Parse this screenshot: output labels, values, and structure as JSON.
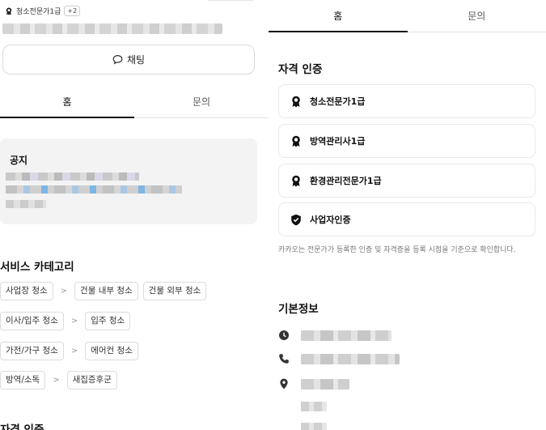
{
  "left": {
    "badge": {
      "label": "청소전문가1급",
      "more": "+2",
      "icon": "medal-icon"
    },
    "chat_button": {
      "label": "채팅",
      "icon": "chat-bubble-icon"
    },
    "tabs": [
      {
        "label": "홈"
      },
      {
        "label": "문의"
      }
    ],
    "notice": {
      "title": "공지"
    },
    "service_category": {
      "title": "서비스 카테고리",
      "rows": [
        {
          "parent": "사업장 청소",
          "children": [
            "건물 내부 청소",
            "건물 외부 청소"
          ]
        },
        {
          "parent": "이사/입주 청소",
          "children": [
            "입주 청소"
          ]
        },
        {
          "parent": "가전/가구 청소",
          "children": [
            "에어컨 청소"
          ]
        },
        {
          "parent": "방역/소독",
          "children": [
            "새집증후군"
          ]
        }
      ]
    },
    "cert_title_peek": "자격 인증"
  },
  "right": {
    "tabs": [
      {
        "label": "홈"
      },
      {
        "label": "문의"
      }
    ],
    "certs": {
      "title": "자격 인증",
      "items": [
        {
          "label": "청소전문가1급",
          "icon": "medal-icon"
        },
        {
          "label": "방역관리사1급",
          "icon": "medal-icon"
        },
        {
          "label": "환경관리전문가1급",
          "icon": "medal-icon"
        },
        {
          "label": "사업자인증",
          "icon": "shield-check-icon"
        }
      ],
      "notice": "카카오는 전문가가 등록한 인증 및 자격증을 등록 시점을 기준으로 확인합니다."
    },
    "basic_info": {
      "title": "기본정보",
      "icons": [
        "clock-icon",
        "phone-icon",
        "location-pin-icon"
      ]
    }
  }
}
